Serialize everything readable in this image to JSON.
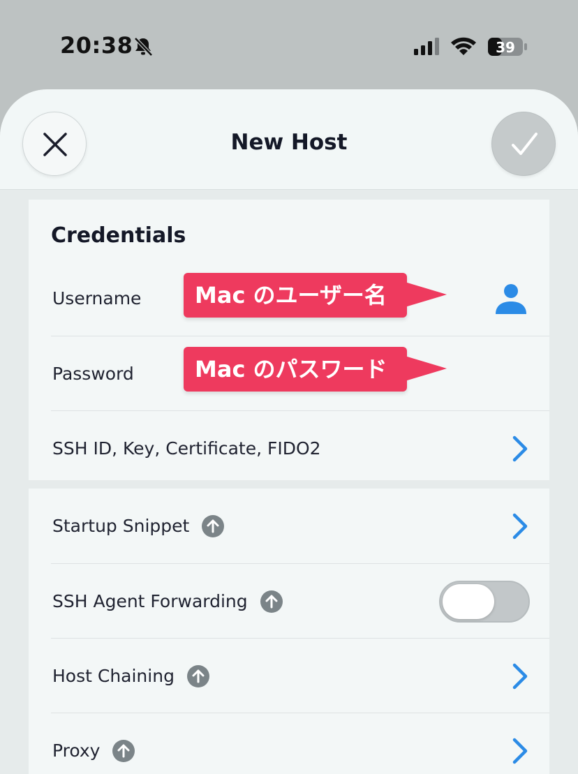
{
  "status_bar": {
    "time": "20:38",
    "battery_level": "39",
    "icons": [
      "bell-slash-icon",
      "cellular-signal-icon",
      "wifi-icon",
      "battery-icon"
    ]
  },
  "header": {
    "title": "New Host",
    "close_icon": "close-icon",
    "confirm_icon": "checkmark-icon"
  },
  "credentials": {
    "title": "Credentials",
    "username_label": "Username",
    "password_label": "Password",
    "ssh_label": "SSH ID, Key, Certificate, FIDO2"
  },
  "annotations": {
    "username_callout": "Mac のユーザー名",
    "password_callout": "Mac のパスワード"
  },
  "advanced": {
    "items": [
      {
        "label": "Startup Snippet",
        "control": "chevron"
      },
      {
        "label": "SSH Agent Forwarding",
        "control": "toggle",
        "toggle_on": false
      },
      {
        "label": "Host Chaining",
        "control": "chevron"
      },
      {
        "label": "Proxy",
        "control": "chevron"
      }
    ]
  },
  "colors": {
    "accent": "#2b8be6",
    "callout": "#ee3a5e",
    "upgrade_badge": "#7b8488",
    "toggle_off": "#c2c7c9"
  }
}
